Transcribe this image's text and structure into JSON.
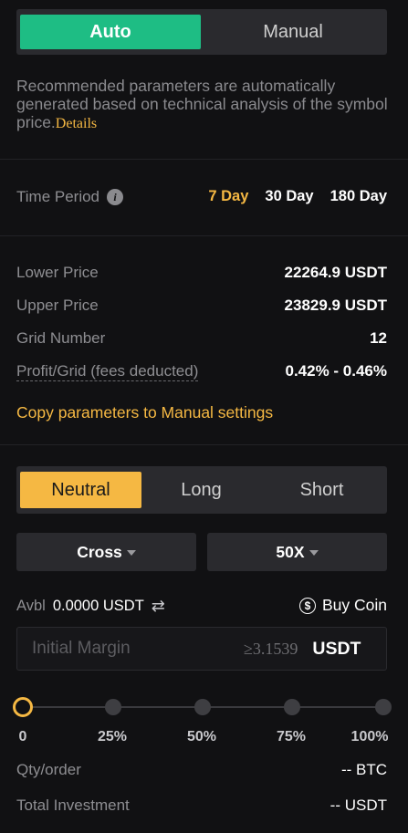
{
  "mode_toggle": {
    "auto": "Auto",
    "manual": "Manual"
  },
  "description": {
    "text": "Recommended parameters are automatically generated based on technical analysis of the symbol price.",
    "details_link": "Details"
  },
  "time_period": {
    "label": "Time Period",
    "options": [
      "7 Day",
      "30 Day",
      "180 Day"
    ],
    "selected": "7 Day"
  },
  "parameters": [
    {
      "label": "Lower Price",
      "value": "22264.9 USDT"
    },
    {
      "label": "Upper Price",
      "value": "23829.9 USDT"
    },
    {
      "label": "Grid Number",
      "value": "12"
    },
    {
      "label": "Profit/Grid (fees deducted)",
      "value": "0.42% - 0.46%"
    }
  ],
  "copy_link": "Copy parameters to Manual settings",
  "direction": {
    "options": [
      "Neutral",
      "Long",
      "Short"
    ],
    "selected": "Neutral"
  },
  "margin_mode": "Cross",
  "leverage": "50X",
  "available": {
    "label": "Avbl",
    "value": "0.0000 USDT"
  },
  "buy_coin": "Buy Coin",
  "initial_margin": {
    "placeholder": "Initial Margin",
    "min": "≥3.1539",
    "unit": "USDT"
  },
  "slider": {
    "labels": [
      "0",
      "25%",
      "50%",
      "75%",
      "100%"
    ],
    "value_percent": 0
  },
  "qty_order": {
    "label": "Qty/order",
    "value": "-- BTC"
  },
  "total_investment": {
    "label": "Total Investment",
    "value": "-- USDT"
  },
  "colors": {
    "accent_green": "#1ebd84",
    "accent_yellow": "#f5b843",
    "background": "#111113",
    "panel": "#2a2a2e"
  }
}
